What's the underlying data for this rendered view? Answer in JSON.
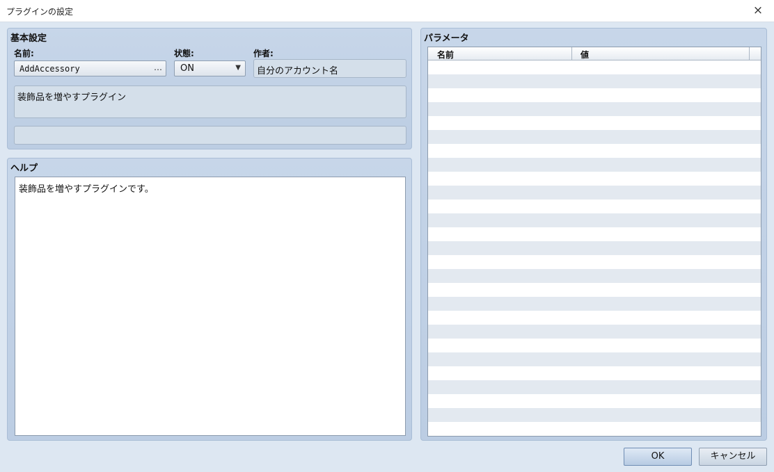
{
  "window": {
    "title": "プラグインの設定",
    "close_glyph": "×"
  },
  "basic": {
    "title": "基本設定",
    "name_label": "名前:",
    "name_value": "AddAccessory",
    "name_browse_glyph": "…",
    "status_label": "状態:",
    "status_value": "ON",
    "status_arrow": "▼",
    "author_label": "作者:",
    "author_value": "自分のアカウント名",
    "description": "装飾品を増やすプラグイン",
    "extra": ""
  },
  "help": {
    "title": "ヘルプ",
    "text": "装飾品を増やすプラグインです。"
  },
  "params": {
    "title": "パラメータ",
    "columns": [
      "名前",
      "値"
    ],
    "rows": []
  },
  "buttons": {
    "ok": "OK",
    "cancel": "キャンセル"
  }
}
